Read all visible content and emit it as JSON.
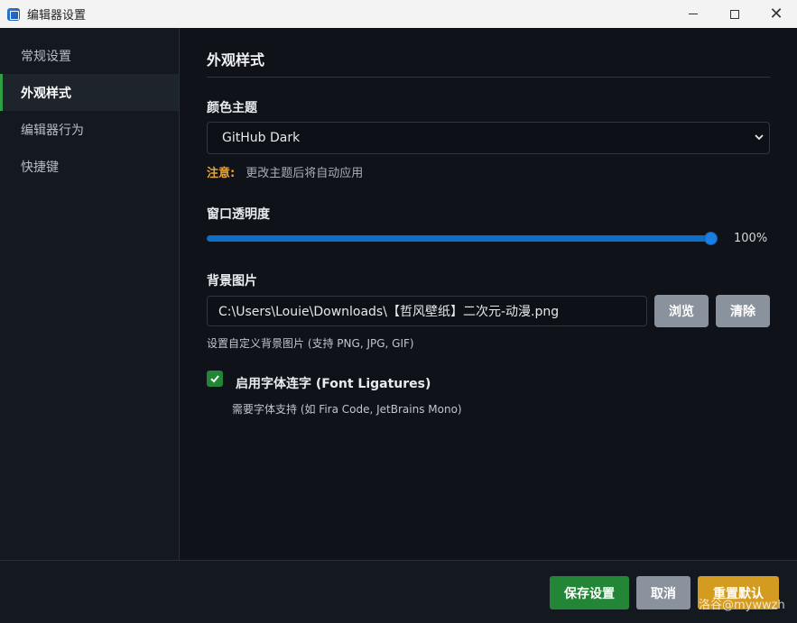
{
  "window": {
    "title": "编辑器设置"
  },
  "sidebar": {
    "items": [
      {
        "label": "常规设置",
        "active": false
      },
      {
        "label": "外观样式",
        "active": true
      },
      {
        "label": "编辑器行为",
        "active": false
      },
      {
        "label": "快捷键",
        "active": false
      }
    ]
  },
  "main": {
    "section_title": "外观样式",
    "color_theme": {
      "label": "颜色主题",
      "selected": "GitHub Dark",
      "note_label": "注意:",
      "note_text": "更改主题后将自动应用"
    },
    "opacity": {
      "label": "窗口透明度",
      "value": 100,
      "value_text": "100%"
    },
    "background_image": {
      "label": "背景图片",
      "path": "C:\\Users\\Louie\\Downloads\\【哲风壁纸】二次元-动漫.png",
      "browse_label": "浏览",
      "clear_label": "清除",
      "hint": "设置自定义背景图片 (支持 PNG, JPG, GIF)"
    },
    "ligatures": {
      "checked": true,
      "label": "启用字体连字 (Font Ligatures)",
      "hint": "需要字体支持 (如 Fira Code, JetBrains Mono)"
    }
  },
  "footer": {
    "save_label": "保存设置",
    "cancel_label": "取消",
    "reset_label": "重置默认"
  },
  "watermark": "洛谷@mywwzh",
  "colors": {
    "accent_green": "#238636",
    "accent_blue": "#0b6fc7",
    "warning": "#e3a53c",
    "reset_orange": "#d39b20"
  }
}
